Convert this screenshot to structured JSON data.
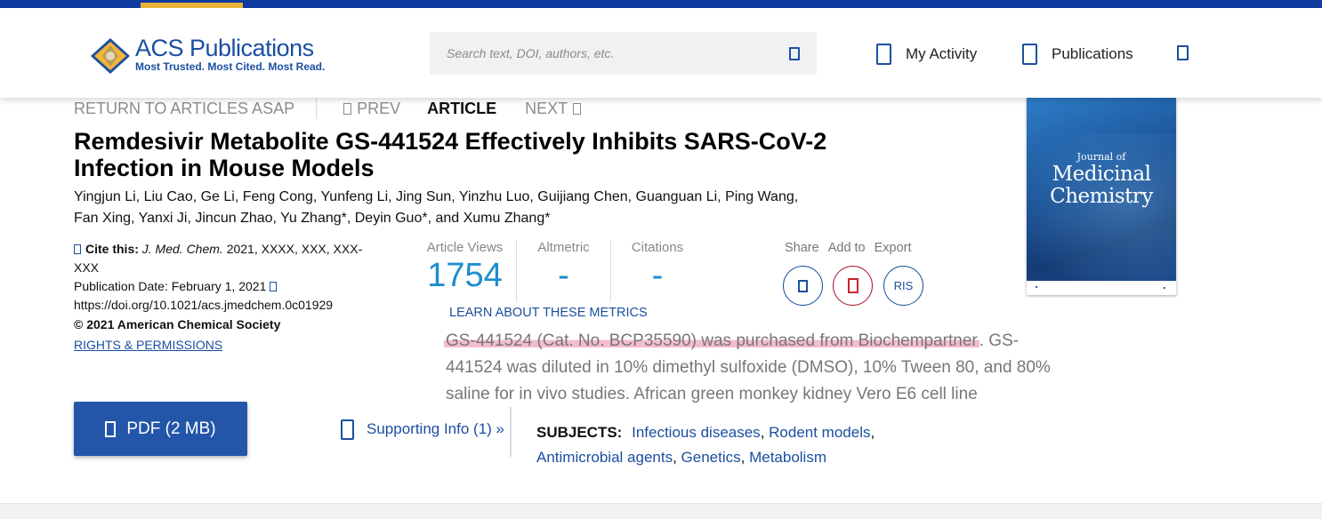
{
  "header": {
    "brand_title": "ACS Publications",
    "brand_tagline": "Most Trusted. Most Cited. Most Read.",
    "search_placeholder": "Search text, DOI, authors, etc.",
    "nav": [
      "My Activity",
      "Publications"
    ],
    "colors": {
      "primary": "#1b4fa0",
      "topbar": "#0f3a9e",
      "accent": "#e8b33a"
    }
  },
  "article_nav": {
    "return": "RETURN TO ARTICLES ASAP",
    "prev": "PREV",
    "current": "ARTICLE",
    "next": "NEXT"
  },
  "article": {
    "title": "Remdesivir Metabolite GS-441524 Effectively Inhibits SARS-CoV-2 Infection in Mouse Models",
    "authors_line1": "Yingjun Li, Liu Cao, Ge Li, Feng Cong, Yunfeng Li, Jing Sun, Yinzhu Luo, Guijiang Chen, Guanguan Li, Ping Wang,",
    "authors_line2": "Fan Xing, Yanxi Ji, Jincun Zhao, Yu Zhang*, Deyin Guo*, and Xumu Zhang*"
  },
  "citation": {
    "cite_label": "Cite this:",
    "journal": "J. Med. Chem.",
    "details": "2021, XXXX, XXX, XXX-XXX",
    "pub_date": "Publication Date: February 1, 2021",
    "doi": "https://doi.org/10.1021/acs.jmedchem.0c01929",
    "copyright": "© 2021 American Chemical Society",
    "rights": "RIGHTS & PERMISSIONS"
  },
  "metrics": {
    "views_label": "Article Views",
    "views_value": "1754",
    "altmetric_label": "Altmetric",
    "altmetric_value": "-",
    "citations_label": "Citations",
    "citations_value": "-",
    "learn_more": "LEARN ABOUT THESE METRICS"
  },
  "actions": {
    "share": "Share",
    "add_to": "Add to",
    "export": "Export",
    "export_format": "RIS"
  },
  "cover": {
    "journal_small": "Journal of",
    "journal_large_1": "Medicinal",
    "journal_large_2": "Chemistry"
  },
  "excerpt": {
    "highlighted": "GS-441524 (Cat. No. BCP35590) was purchased from Biochempartner",
    "rest": ". GS-441524 was diluted in 10% dimethyl sulfoxide (DMSO), 10% Tween 80, and 80% saline for in vivo studies. African green monkey kidney Vero E6 cell line",
    "highlight_color": "#ec87a0"
  },
  "pdf_button": "PDF (2 MB)",
  "supporting_info": "Supporting Info (1) »",
  "subjects": {
    "label": "SUBJECTS:",
    "items": [
      "Infectious diseases",
      "Rodent models",
      "Antimicrobial agents",
      "Genetics",
      "Metabolism"
    ]
  }
}
